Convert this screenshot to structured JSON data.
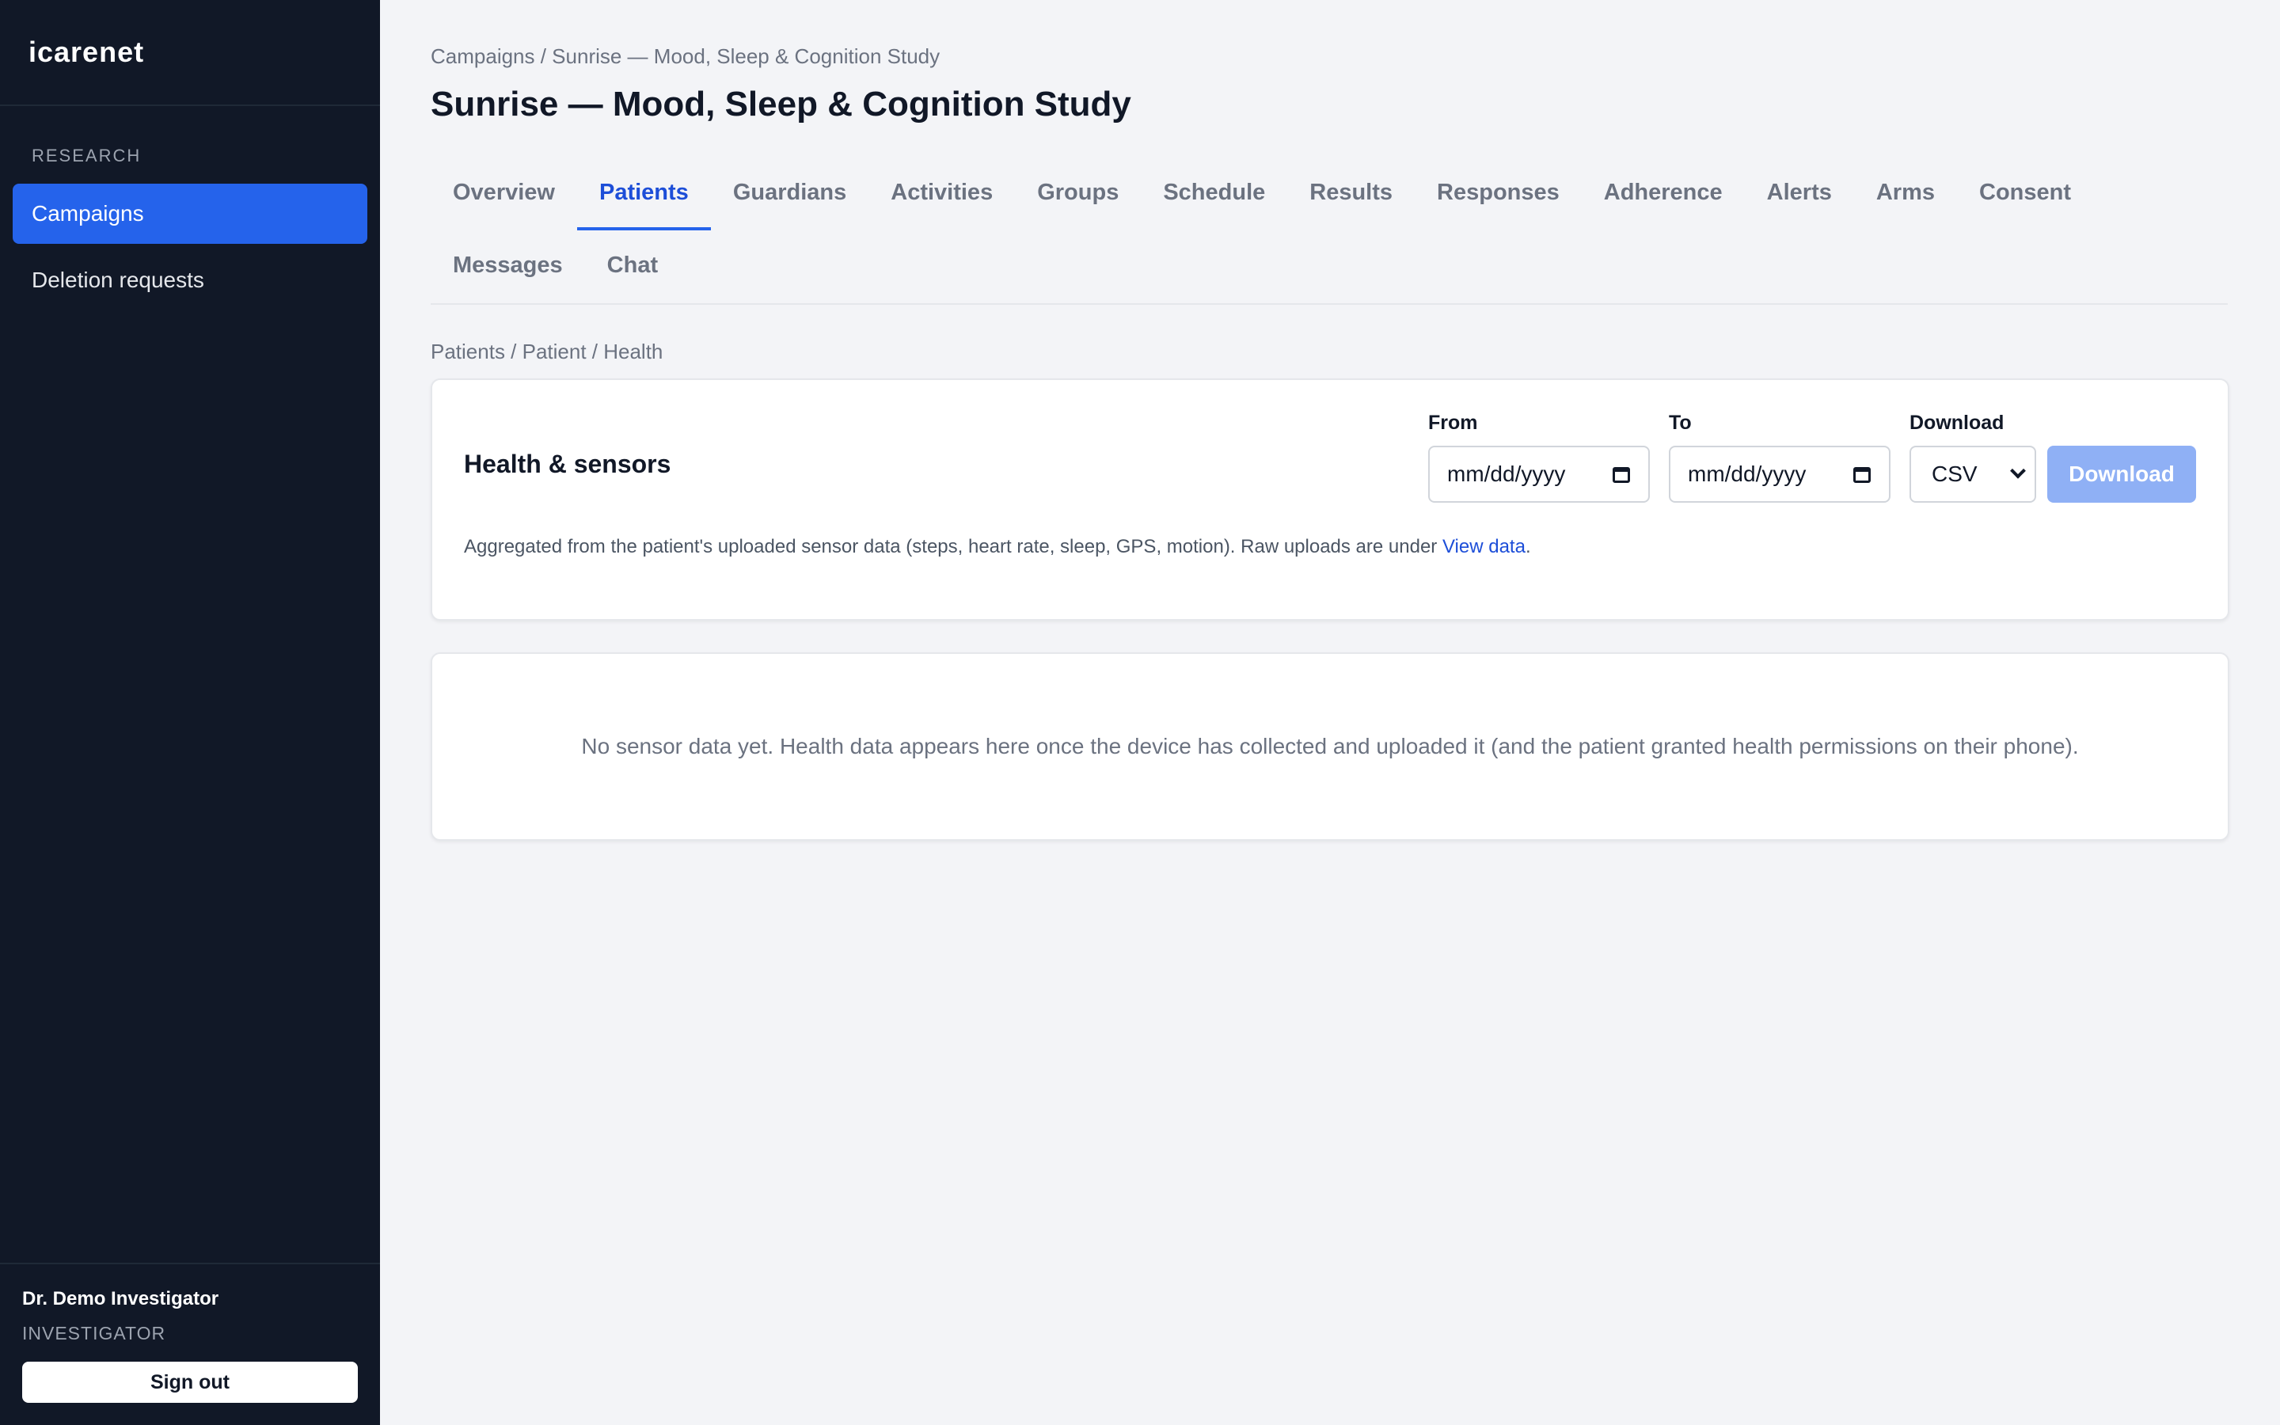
{
  "app": {
    "name": "icarenet"
  },
  "sidebar": {
    "section": "RESEARCH",
    "items": [
      {
        "label": "Campaigns",
        "active": true
      },
      {
        "label": "Deletion requests",
        "active": false
      }
    ],
    "user": {
      "name": "Dr. Demo Investigator",
      "role": "INVESTIGATOR"
    },
    "signout_label": "Sign out"
  },
  "header": {
    "breadcrumb": "Campaigns / Sunrise — Mood, Sleep & Cognition Study",
    "title": "Sunrise — Mood, Sleep & Cognition Study"
  },
  "tabs": [
    "Overview",
    "Patients",
    "Guardians",
    "Activities",
    "Groups",
    "Schedule",
    "Results",
    "Responses",
    "Adherence",
    "Alerts",
    "Arms",
    "Consent",
    "Messages",
    "Chat"
  ],
  "active_tab": "Patients",
  "subbreadcrumb": "Patients / Patient / Health",
  "health": {
    "title": "Health & sensors",
    "from_label": "From",
    "from_placeholder": "mm/dd/yyyy",
    "to_label": "To",
    "to_placeholder": "mm/dd/yyyy",
    "download_label": "Download",
    "format_value": "CSV",
    "download_button": "Download",
    "description_prefix": "Aggregated from the patient's uploaded sensor data (steps, heart rate, sleep, GPS, motion). Raw uploads are under ",
    "description_link": "View data",
    "description_suffix": "."
  },
  "empty_state": "No sensor data yet. Health data appears here once the device has collected and uploaded it (and the patient granted health permissions on their phone).",
  "colors": {
    "sidebar_bg": "#111827",
    "accent": "#2563eb",
    "download_button_disabled": "#8fb0f5",
    "page_bg": "#f3f4f7"
  }
}
